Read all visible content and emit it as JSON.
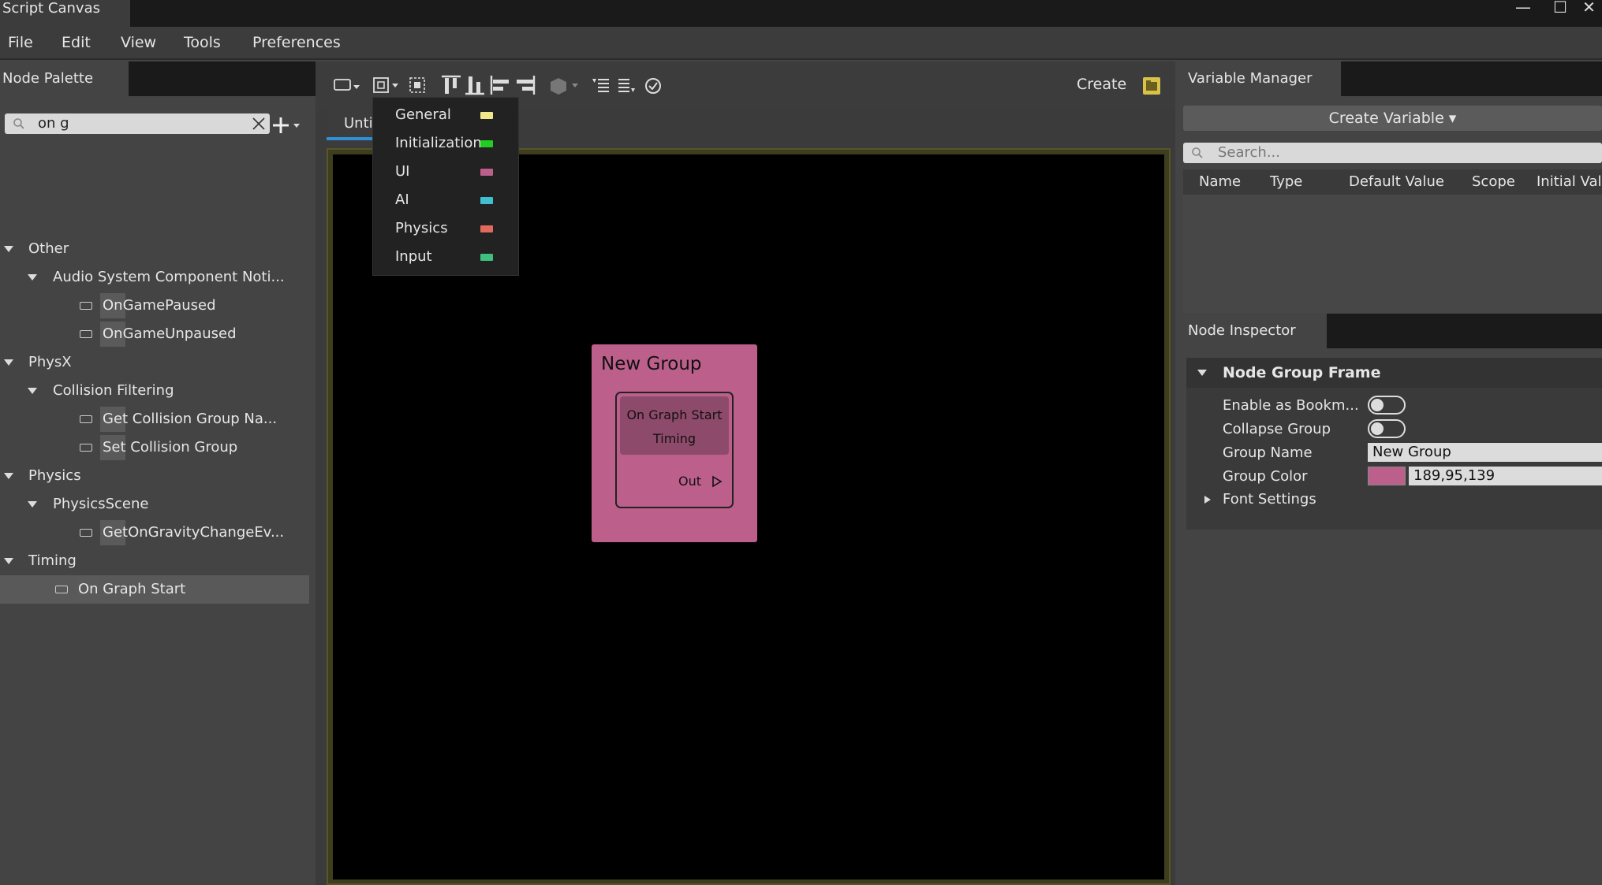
{
  "window": {
    "title": "Script Canvas",
    "minimize": "—",
    "maximize": "☐",
    "close": "✕"
  },
  "menu": [
    "File",
    "Edit",
    "View",
    "Tools",
    "Preferences"
  ],
  "palette": {
    "tab": "Node Palette",
    "search_value": "on g",
    "tree": [
      {
        "label": "Other",
        "level": 0
      },
      {
        "label": "Audio System Component Noti...",
        "level": 1
      },
      {
        "label": "OnGamePaused",
        "level": 2
      },
      {
        "label": "OnGameUnpaused",
        "level": 2
      },
      {
        "label": "PhysX",
        "level": 0
      },
      {
        "label": "Collision Filtering",
        "level": 1
      },
      {
        "label": "Get Collision Group Na...",
        "level": 2
      },
      {
        "label": "Set Collision Group",
        "level": 2
      },
      {
        "label": "Physics",
        "level": 0
      },
      {
        "label": "PhysicsScene",
        "level": 1
      },
      {
        "label": "GetOnGravityChangeEv...",
        "level": 2
      },
      {
        "label": "Timing",
        "level": 0
      },
      {
        "label": "On Graph Start",
        "level": 1
      }
    ]
  },
  "toolbar": {
    "create_label": "Create",
    "accent": "#d8c24a"
  },
  "doc_tab": "Unti",
  "group_menu": [
    {
      "label": "General",
      "color": "#f0e68c"
    },
    {
      "label": "Initialization",
      "color": "#22cc22"
    },
    {
      "label": "UI",
      "color": "#bd5f8b"
    },
    {
      "label": "AI",
      "color": "#3fbfcf"
    },
    {
      "label": "Physics",
      "color": "#e06a5c"
    },
    {
      "label": "Input",
      "color": "#3fbf7f"
    }
  ],
  "group": {
    "title": "New Group",
    "node_title": "On Graph Start",
    "node_sub": "Timing",
    "out_label": "Out",
    "color": "#bd5f8b"
  },
  "variable_manager": {
    "tab": "Variable Manager",
    "create_button": "Create Variable ▾",
    "search_placeholder": "Search...",
    "columns": [
      "Name",
      "Type",
      "Default Value",
      "Scope",
      "Initial Valu"
    ]
  },
  "node_inspector": {
    "tab": "Node Inspector",
    "section": "Node Group Frame",
    "props": {
      "bookmark_label": "Enable as Bookm...",
      "collapse_label": "Collapse Group",
      "name_label": "Group Name",
      "name_value": "New Group",
      "color_label": "Group Color",
      "color_value": "189,95,139",
      "font_label": "Font Settings"
    }
  }
}
